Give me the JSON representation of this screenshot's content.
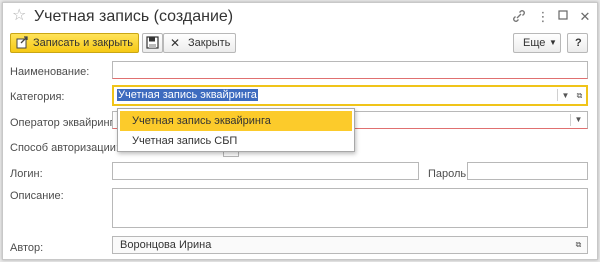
{
  "window": {
    "title": "Учетная запись (создание)"
  },
  "toolbar": {
    "save_close_label": "Записать и закрыть",
    "close_label": "Закрыть",
    "more_label": "Еще",
    "help_label": "?"
  },
  "form": {
    "name_label": "Наименование:",
    "name_value": "",
    "category_label": "Категория:",
    "category_value": "Учетная запись эквайринга",
    "operator_label": "Оператор эквайринга:",
    "operator_value": "",
    "auth_label": "Способ авторизации:",
    "login_label": "Логин:",
    "login_value": "",
    "password_label": "Пароль:",
    "password_value": "",
    "description_label": "Описание:",
    "description_value": "",
    "author_label": "Автор:",
    "author_value": "Воронцова Ирина"
  },
  "category_dropdown": {
    "options": [
      "Учетная запись эквайринга",
      "Учетная запись СБП"
    ],
    "highlighted_index": 0
  },
  "colors": {
    "primary_button": "#f6c915",
    "focus_border": "#f0c419",
    "selection": "#3d6bbf",
    "highlight": "#fccb2b"
  }
}
